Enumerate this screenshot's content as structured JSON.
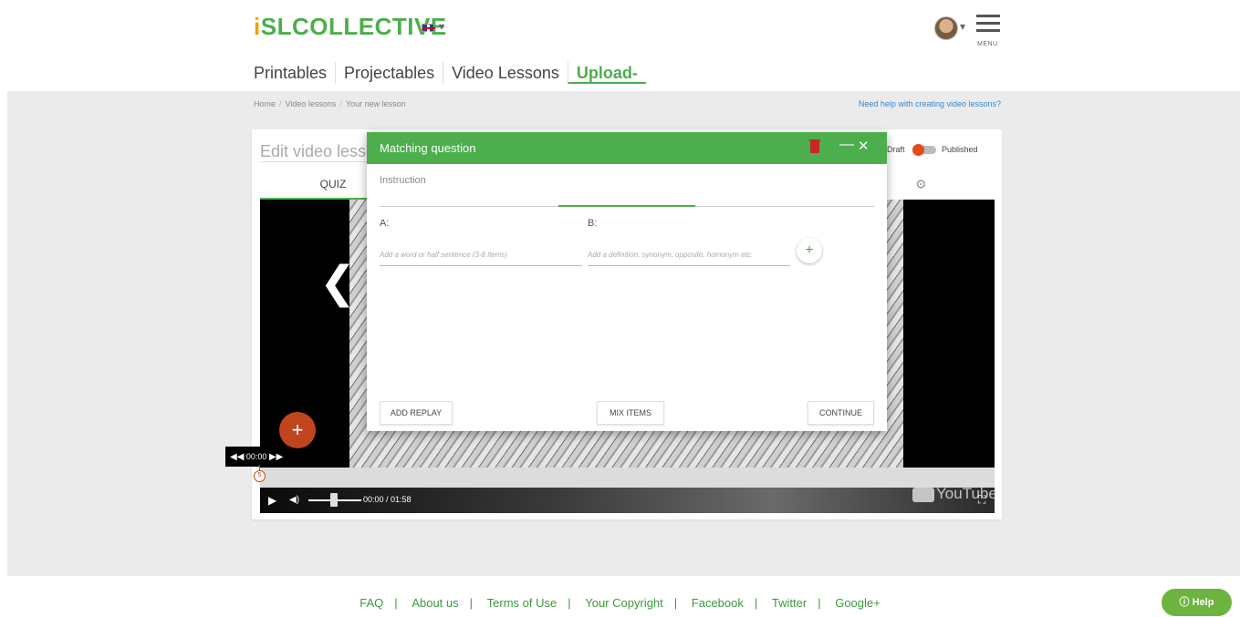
{
  "header": {
    "logo_i": "i",
    "logo_rest": "SLCOLLECTIVE",
    "menu_label": "MENU"
  },
  "nav": [
    {
      "label": "Printables"
    },
    {
      "label": "Projectables"
    },
    {
      "label": "Video Lessons"
    },
    {
      "label": "Upload",
      "caret": "-"
    }
  ],
  "breadcrumb": [
    "Home",
    "Video lessons",
    "Your new lesson"
  ],
  "help_link": "Need help with creating video lessons?",
  "editor": {
    "title": "Edit video lesson",
    "tab_quiz": "QUIZ",
    "draft": "Draft",
    "published": "Published"
  },
  "video": {
    "time_nav": "00:00",
    "marker": "5",
    "time_readout": "00:00 / 01:58",
    "youtube": "YouTube"
  },
  "modal": {
    "title": "Matching question",
    "instruction_placeholder": "Instruction",
    "col_a": "A:",
    "col_b": "B:",
    "input_a_placeholder": "Add a word or half sentence (3-8 items)",
    "input_b_placeholder": "Add a definition, synonym, opposite, homonym etc.",
    "add_replay": "ADD REPLAY",
    "mix_items": "MIX ITEMS",
    "continue": "CONTINUE"
  },
  "footer": [
    "FAQ",
    "About us",
    "Terms of Use",
    "Your Copyright",
    "Facebook",
    "Twitter",
    "Google+"
  ],
  "help_button": "Help",
  "colors": {
    "brand_green": "#4cae4c",
    "logo_orange": "#f0a000",
    "accent_red": "#c0451f",
    "link_blue": "#3a87c9"
  }
}
